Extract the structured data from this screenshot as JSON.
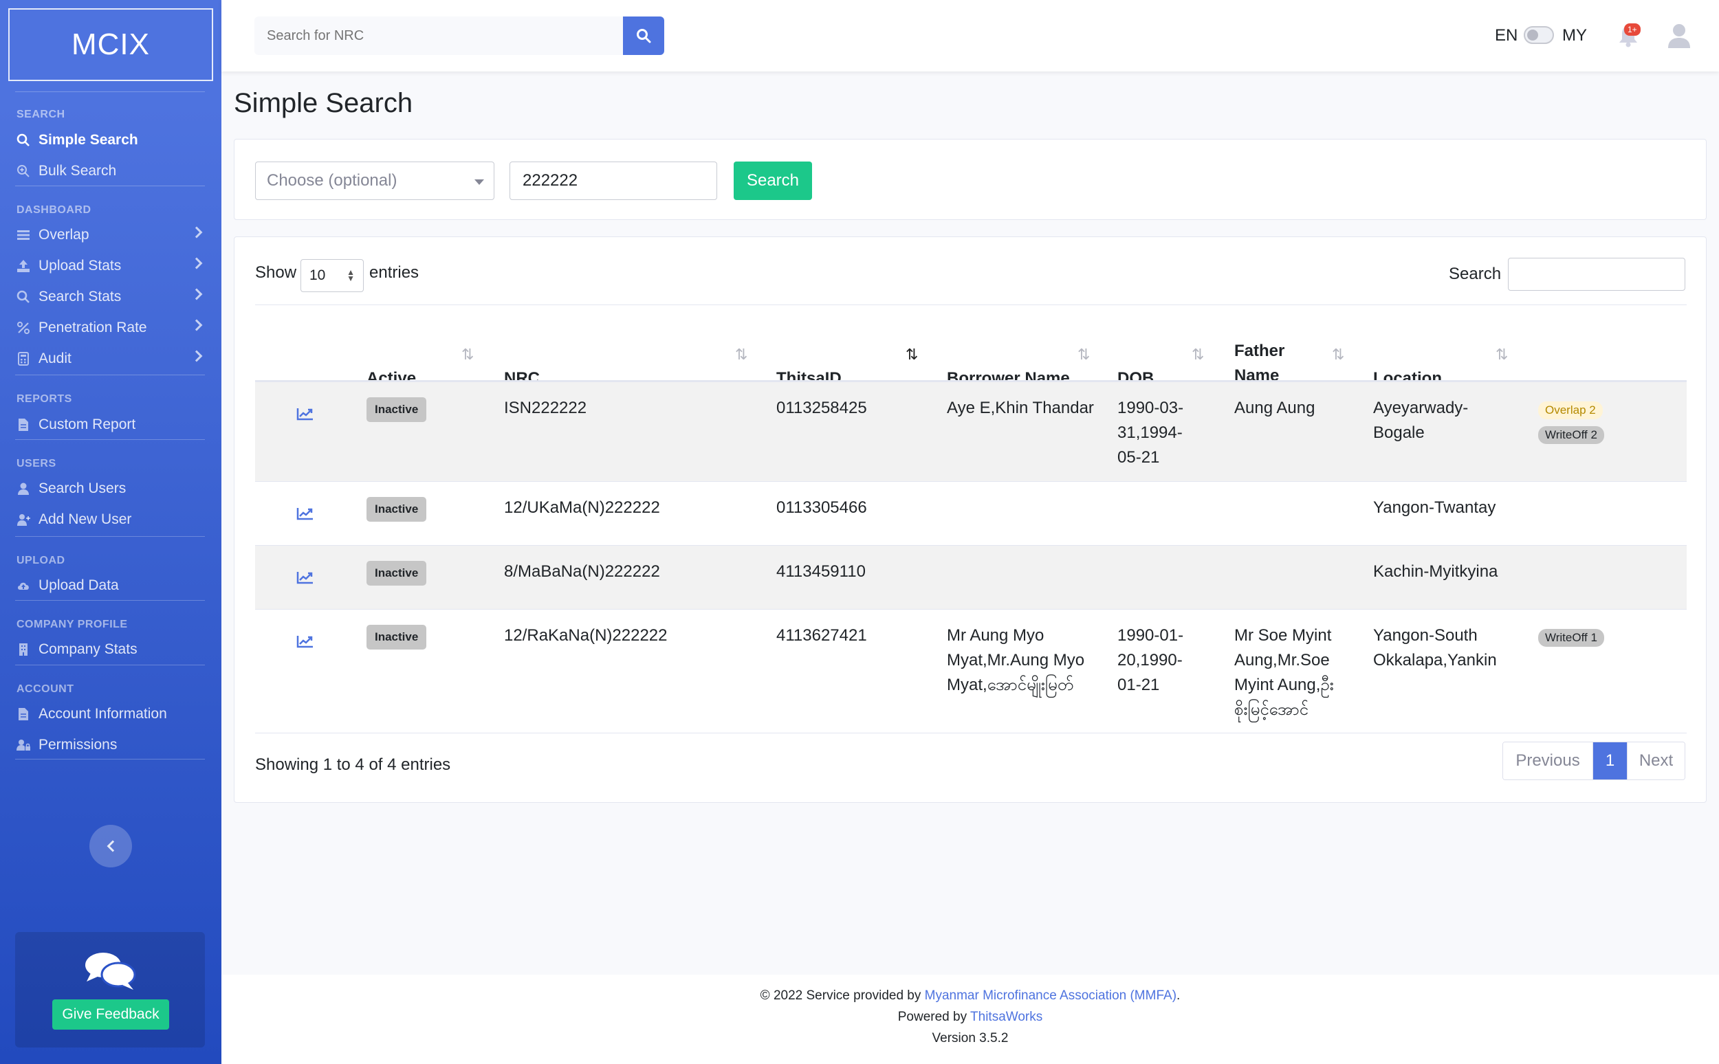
{
  "brand": "MCIX",
  "sidebar": {
    "sections": [
      {
        "heading": "SEARCH",
        "items": [
          {
            "label": "Simple Search",
            "icon": "search-icon",
            "active": true
          },
          {
            "label": "Bulk Search",
            "icon": "search-plus-icon"
          }
        ]
      },
      {
        "heading": "DASHBOARD",
        "items": [
          {
            "label": "Overlap",
            "icon": "bars-icon"
          },
          {
            "label": "Upload Stats",
            "icon": "upload-icon"
          },
          {
            "label": "Search Stats",
            "icon": "search-icon"
          },
          {
            "label": "Penetration Rate",
            "icon": "percent-icon"
          },
          {
            "label": "Audit",
            "icon": "calculator-icon"
          }
        ]
      },
      {
        "heading": "REPORTS",
        "items": [
          {
            "label": "Custom Report",
            "icon": "file-icon"
          }
        ]
      },
      {
        "heading": "USERS",
        "items": [
          {
            "label": "Search Users",
            "icon": "user-icon"
          },
          {
            "label": "Add New User",
            "icon": "user-plus-icon"
          }
        ]
      },
      {
        "heading": "UPLOAD",
        "items": [
          {
            "label": "Upload Data",
            "icon": "cloud-upload-icon"
          }
        ]
      },
      {
        "heading": "COMPANY PROFILE",
        "items": [
          {
            "label": "Company Stats",
            "icon": "building-icon"
          }
        ]
      },
      {
        "heading": "ACCOUNT",
        "items": [
          {
            "label": "Account Information",
            "icon": "file-icon"
          },
          {
            "label": "Permissions",
            "icon": "users-lock-icon"
          }
        ]
      }
    ],
    "feedback_label": "Give Feedback"
  },
  "topbar": {
    "search_placeholder": "Search for NRC",
    "lang_en": "EN",
    "lang_my": "MY",
    "notification_count": "1+"
  },
  "page_title": "Simple Search",
  "form": {
    "select_placeholder": "Choose (optional)",
    "nrc_value": "222222",
    "search_label": "Search"
  },
  "table": {
    "show_label": "Show",
    "entries_value": "10",
    "entries_label": "entries",
    "search_label": "Search",
    "headers": {
      "active": "Active",
      "nrc": "NRC",
      "thitsaid": "ThitsaID",
      "borrower": "Borrower Name",
      "dob": "DOB",
      "father_line1": "Father",
      "father_line2": "Name",
      "location": "Location"
    },
    "rows": [
      {
        "status": "Inactive",
        "nrc": "ISN222222",
        "thitsaid": "0113258425",
        "borrower": "Aye E,Khin Thandar",
        "dob": "1990-03-\n31,1994-\n05-21",
        "father": "Aung Aung",
        "location": "Ayeyarwady-\nBogale",
        "tags": [
          {
            "label": "Overlap 2",
            "kind": "overlap"
          },
          {
            "label": "WriteOff 2",
            "kind": "writeoff"
          }
        ]
      },
      {
        "status": "Inactive",
        "nrc": "12/UKaMa(N)222222",
        "thitsaid": "0113305466",
        "borrower": "",
        "dob": "",
        "father": "",
        "location": "Yangon-Twantay",
        "tags": []
      },
      {
        "status": "Inactive",
        "nrc": "8/MaBaNa(N)222222",
        "thitsaid": "4113459110",
        "borrower": "",
        "dob": "",
        "father": "",
        "location": "Kachin-Myitkyina",
        "tags": []
      },
      {
        "status": "Inactive",
        "nrc": "12/RaKaNa(N)222222",
        "thitsaid": "4113627421",
        "borrower": "Mr Aung Myo\nMyat,Mr.Aung Myo\nMyat,အောင်မျိုးမြတ်",
        "dob": "1990-01-\n20,1990-\n01-21",
        "father": "Mr Soe Myint\nAung,Mr.Soe\nMyint Aung,ဦး\nစိုးမြင့်အောင်",
        "location": "Yangon-South\nOkkalapa,Yankin",
        "tags": [
          {
            "label": "WriteOff 1",
            "kind": "writeoff"
          }
        ]
      }
    ],
    "showing_text": "Showing 1 to 4 of 4 entries",
    "pagination": {
      "previous": "Previous",
      "current": "1",
      "next": "Next"
    }
  },
  "footer": {
    "line1_prefix": "© 2022 Service provided by ",
    "line1_link": "Myanmar Microfinance Association (MMFA)",
    "line1_suffix": ".",
    "line2_prefix": "Powered by ",
    "line2_link": "ThitsaWorks",
    "line3": "Version 3.5.2"
  }
}
